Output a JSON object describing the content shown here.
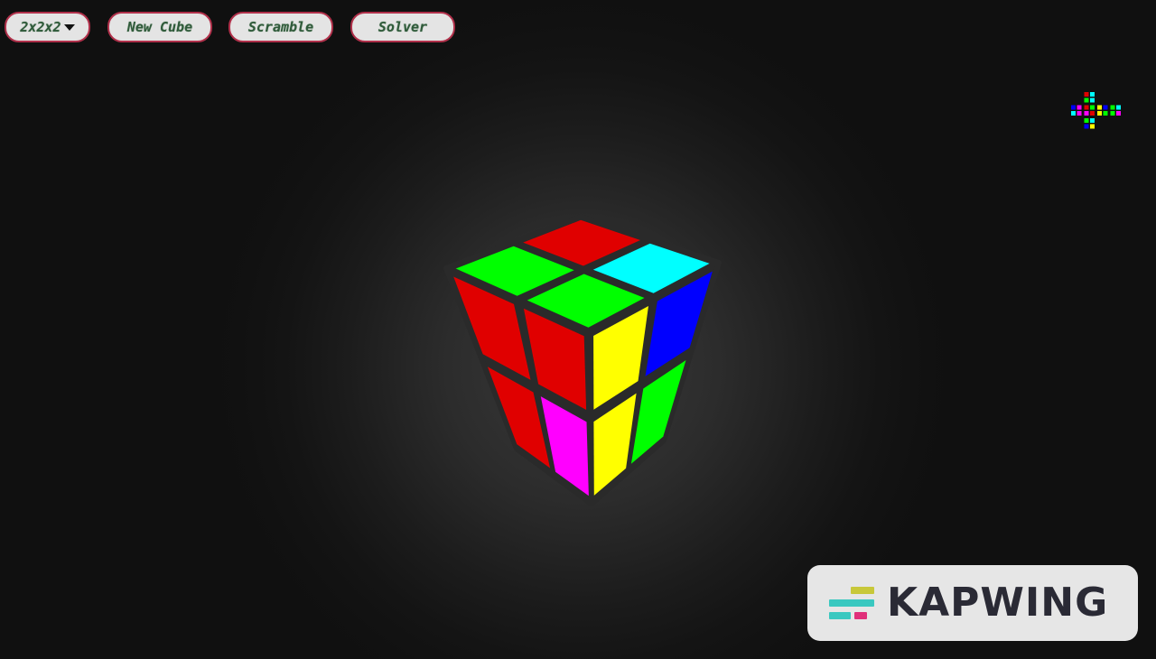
{
  "toolbar": {
    "size_select_value": "2x2x2",
    "new_cube_label": "New Cube",
    "scramble_label": "Scramble",
    "solver_label": "Solver"
  },
  "cube": {
    "size": 2,
    "colors": {
      "red": "#e00000",
      "green": "#00ff00",
      "cyan": "#00ffff",
      "blue": "#0000ff",
      "yellow": "#ffff00",
      "magenta": "#ff00ff"
    },
    "top_face": [
      "green",
      "red",
      "green",
      "cyan"
    ],
    "left_face": [
      "red",
      "red",
      "red",
      "magenta"
    ],
    "right_face": [
      "yellow",
      "blue",
      "yellow",
      "green"
    ]
  },
  "cube_map": {
    "U": [
      "red",
      "cyan",
      "green",
      "cyan"
    ],
    "L": [
      "blue",
      "magenta",
      "cyan",
      "magenta"
    ],
    "F": [
      "red",
      "green",
      "magenta",
      "red"
    ],
    "R": [
      "yellow",
      "blue",
      "yellow",
      "green"
    ],
    "B": [
      "green",
      "cyan",
      "green",
      "magenta"
    ],
    "D": [
      "green",
      "cyan",
      "blue",
      "yellow"
    ]
  },
  "watermark": {
    "text": "KAPWING",
    "logo_colors": [
      "#c8c83a",
      "#3ac8c0",
      "#e0307a"
    ]
  }
}
